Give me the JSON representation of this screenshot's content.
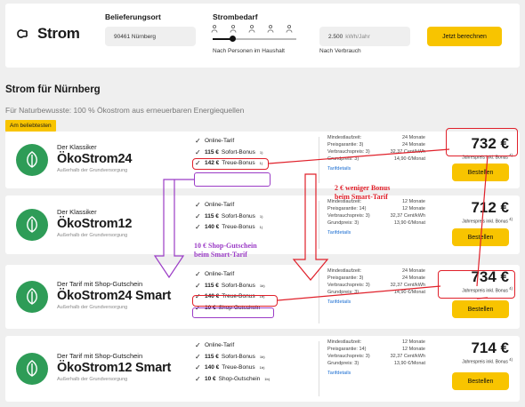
{
  "logo": {
    "name": "Strom",
    "icon": "plug-icon"
  },
  "search": {
    "location_label": "Belieferungsort",
    "location_value": "90461 Nürnberg",
    "need_label": "Strombedarf",
    "persons_label": "Nach Personen im Haushalt",
    "consumption_value": "2.500",
    "consumption_unit": "kWh/Jahr",
    "consumption_label": "Nach Verbrauch",
    "submit_label": "Jetzt berechnen"
  },
  "page": {
    "title": "Strom für Nürnberg",
    "subtitle": "Für Naturbewusste: 100 % Ökostrom aus erneuerbaren Energiequellen",
    "popular_badge": "Am beliebtesten"
  },
  "tariffs": [
    {
      "tagline": "Der Klassiker",
      "name": "ÖkoStrom24",
      "note": "Außerhalb der Grundversorgung",
      "features": [
        {
          "text": "Online-Tarif",
          "sup": ""
        },
        {
          "bold": "115 €",
          "text": " Sofort-Bonus",
          "sup": "1)"
        },
        {
          "bold": "142 €",
          "text": " Treue-Bonus",
          "sup": "1)"
        }
      ],
      "details": [
        {
          "k": "Mindestlaufzeit:",
          "v": "24 Monate"
        },
        {
          "k": "Preisgarantie: 3)",
          "v": "24 Monate"
        },
        {
          "k": "Verbrauchspreis: 3)",
          "v": "32,37 Cent/kWh"
        },
        {
          "k": "Grundpreis: 3)",
          "v": "14,90 €/Monat"
        }
      ],
      "link": "Tarifdetails",
      "price": "732 €",
      "price_label": "Jahrespreis inkl. Bonus",
      "price_sup": "4)",
      "button": "Bestellen"
    },
    {
      "tagline": "Der Klassiker",
      "name": "ÖkoStrom12",
      "note": "Außerhalb der Grundversorgung",
      "features": [
        {
          "text": "Online-Tarif",
          "sup": ""
        },
        {
          "bold": "115 €",
          "text": " Sofort-Bonus",
          "sup": "1)"
        },
        {
          "bold": "140 €",
          "text": " Treue-Bonus",
          "sup": "1)"
        }
      ],
      "details": [
        {
          "k": "Mindestlaufzeit:",
          "v": "12 Monate"
        },
        {
          "k": "Preisgarantie: 14)",
          "v": "12 Monate"
        },
        {
          "k": "Verbrauchspreis: 3)",
          "v": "32,37 Cent/kWh"
        },
        {
          "k": "Grundpreis: 3)",
          "v": "13,90 €/Monat"
        }
      ],
      "link": "Tarifdetails",
      "price": "712 €",
      "price_label": "Jahrespreis inkl. Bonus",
      "price_sup": "4)",
      "button": "Bestellen"
    },
    {
      "tagline": "Der Tarif mit Shop-Gutschein",
      "name": "ÖkoStrom24 Smart",
      "note": "Außerhalb der Grundversorgung",
      "features": [
        {
          "text": "Online-Tarif",
          "sup": ""
        },
        {
          "bold": "115 €",
          "text": " Sofort-Bonus",
          "sup": "1b)"
        },
        {
          "bold": "140 €",
          "text": " Treue-Bonus",
          "sup": "1b)"
        },
        {
          "bold": "10 €",
          "text": " Shop-Gutschein",
          "sup": ""
        }
      ],
      "details": [
        {
          "k": "Mindestlaufzeit:",
          "v": "24 Monate"
        },
        {
          "k": "Preisgarantie: 3)",
          "v": "24 Monate"
        },
        {
          "k": "Verbrauchspreis: 3)",
          "v": "32,37 Cent/kWh"
        },
        {
          "k": "Grundpreis: 3)",
          "v": "14,90 €/Monat"
        }
      ],
      "link": "Tarifdetails",
      "price": "734 €",
      "price_label": "Jahrespreis inkl. Bonus",
      "price_sup": "4)",
      "button": "Bestellen"
    },
    {
      "tagline": "Der Tarif mit Shop-Gutschein",
      "name": "ÖkoStrom12 Smart",
      "note": "Außerhalb der Grundversorgung",
      "features": [
        {
          "text": "Online-Tarif",
          "sup": ""
        },
        {
          "bold": "115 €",
          "text": " Sofort-Bonus",
          "sup": "1b)"
        },
        {
          "bold": "140 €",
          "text": " Treue-Bonus",
          "sup": "1b)"
        },
        {
          "bold": "10 €",
          "text": " Shop-Gutschein",
          "sup": "1b)"
        }
      ],
      "details": [
        {
          "k": "Mindestlaufzeit:",
          "v": "12 Monate"
        },
        {
          "k": "Preisgarantie: 14)",
          "v": "12 Monate"
        },
        {
          "k": "Verbrauchspreis: 3)",
          "v": "32,37 Cent/kWh"
        },
        {
          "k": "Grundpreis: 3)",
          "v": "13,90 €/Monat"
        }
      ],
      "link": "Tarifdetails",
      "price": "714 €",
      "price_label": "Jahrespreis inkl. Bonus",
      "price_sup": "4)",
      "button": "Bestellen"
    }
  ],
  "annotations": {
    "red_note_1": "2 € weniger Bonus",
    "red_note_2": "beim Smart-Tarif",
    "purple_note_1": "10 € Shop-Gutschein",
    "purple_note_2": "beim Smart-Tarif",
    "colors": {
      "red": "#e0202a",
      "purple": "#9b3cc6",
      "accent": "#f8c400",
      "brand_green": "#2e9c57"
    }
  }
}
